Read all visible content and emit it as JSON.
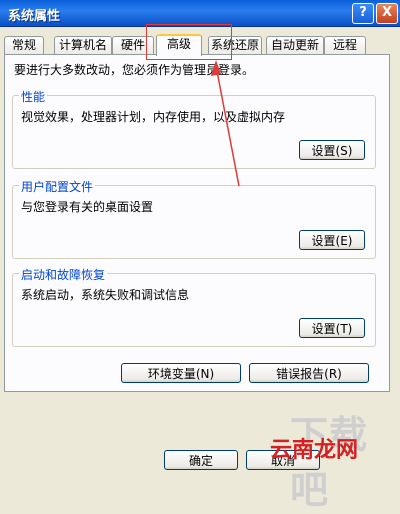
{
  "window": {
    "title": "系统属性",
    "help_label": "?",
    "close_label": "X"
  },
  "tabs": [
    {
      "label": "常规"
    },
    {
      "label": "计算机名"
    },
    {
      "label": "硬件"
    },
    {
      "label": "高级",
      "active": true
    },
    {
      "label": "系统还原"
    },
    {
      "label": "自动更新"
    },
    {
      "label": "远程"
    }
  ],
  "advanced": {
    "notice": "要进行大多数改动，您必须作为管理员登录。",
    "performance": {
      "title": "性能",
      "desc": "视觉效果，处理器计划，内存使用，以及虚拟内存",
      "settings_label": "设置(S)"
    },
    "user_profiles": {
      "title": "用户配置文件",
      "desc": "与您登录有关的桌面设置",
      "settings_label": "设置(E)"
    },
    "startup_recovery": {
      "title": "启动和故障恢复",
      "desc": "系统启动，系统失败和调试信息",
      "settings_label": "设置(T)"
    },
    "env_vars_label": "环境变量(N)",
    "error_report_label": "错误报告(R)"
  },
  "footer": {
    "ok_label": "确定",
    "cancel_label": "取消"
  },
  "watermark": {
    "text": "云南龙网",
    "bg_text": "下载吧"
  },
  "colors": {
    "title_bar": "#0a5fd8",
    "group_title": "#0046d5",
    "highlight": "#e03a3a"
  }
}
